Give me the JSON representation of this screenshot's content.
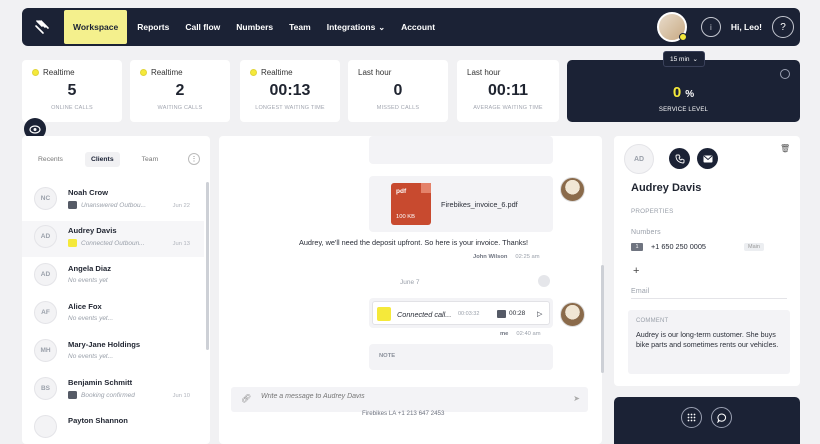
{
  "nav": {
    "items": [
      "Workspace",
      "Reports",
      "Call flow",
      "Numbers",
      "Team",
      "Integrations",
      "Account"
    ],
    "integrations_caret": "⌄",
    "greeting": "Hi, Leo!",
    "info_icon": "i",
    "help_icon": "?"
  },
  "stats": [
    {
      "label": "Realtime",
      "value": "5",
      "sub": "ONLINE CALLS",
      "dot": true
    },
    {
      "label": "Realtime",
      "value": "2",
      "sub": "WAITING CALLS",
      "dot": true
    },
    {
      "label": "Realtime",
      "value": "00:13",
      "sub": "LONGEST WAITING TIME",
      "dot": true
    },
    {
      "label": "Last hour",
      "value": "0",
      "sub": "MISSED CALLS",
      "dot": false
    },
    {
      "label": "Last hour",
      "value": "00:11",
      "sub": "AVERAGE WAITING TIME",
      "dot": false
    }
  ],
  "service_level": {
    "period": "15 min",
    "value": "0",
    "unit": "%",
    "label": "SERVICE LEVEL",
    "accent": "#f5e93a"
  },
  "left_tabs": [
    "Recents",
    "Clients",
    "Team"
  ],
  "left_tabs_active": "Clients",
  "contacts": [
    {
      "initials": "NC",
      "name": "Noah Crow",
      "sub": "Unanswered Outbou...",
      "date": "Jun 22",
      "icon": "dark"
    },
    {
      "initials": "AD",
      "name": "Audrey Davis",
      "sub": "Connected Outboun...",
      "date": "Jun 13",
      "icon": "yellow"
    },
    {
      "initials": "AD",
      "name": "Angela Diaz",
      "sub": "No events yet",
      "date": "",
      "icon": ""
    },
    {
      "initials": "AF",
      "name": "Alice Fox",
      "sub": "No events yet...",
      "date": "",
      "icon": ""
    },
    {
      "initials": "MH",
      "name": "Mary-Jane Holdings",
      "sub": "No events yet...",
      "date": "",
      "icon": ""
    },
    {
      "initials": "BS",
      "name": "Benjamin Schmitt",
      "sub": "Booking confirmed",
      "date": "Jun 10",
      "icon": "dark"
    },
    {
      "initials": "",
      "name": "Payton Shannon",
      "sub": "",
      "date": "",
      "icon": ""
    }
  ],
  "chat": {
    "file_ext": "pdf",
    "file_size": "100 KB",
    "file_name": "Firebikes_invoice_6.pdf",
    "message": "Audrey, we'll need the deposit upfront. So here is your invoice. Thanks!",
    "message_author": "John Wilson",
    "message_time": "02:25 am",
    "day_divider": "June 7",
    "call_label": "Connected call...",
    "call_time": "00:03:32",
    "call_duration": "00:28",
    "call_author": "me",
    "call_meta_time": "02:40 am",
    "note_label": "NOTE",
    "composer_placeholder": "Write a message to Audrey Davis",
    "footer_line": "Firebikes LA +1 213 647 2453"
  },
  "contact_panel": {
    "initials": "AD",
    "name": "Audrey Davis",
    "properties_label": "PROPERTIES",
    "numbers_label": "Numbers",
    "phone_index": "1",
    "phone": "+1 650 250 0005",
    "phone_tag": "Main",
    "add_label": "+",
    "email_label": "Email",
    "comment_label": "COMMENT",
    "comment": "Audrey is our long-term customer. She buys bike parts and sometimes rents our vehicles."
  }
}
